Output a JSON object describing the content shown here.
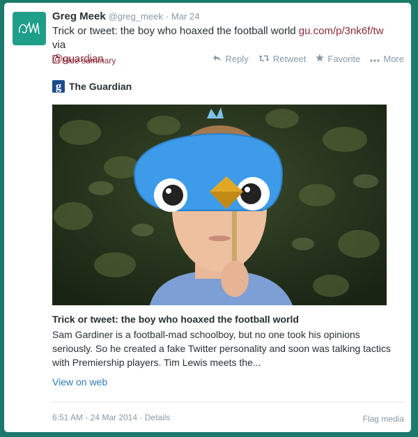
{
  "tweet": {
    "name": "Greg Meek",
    "handle": "@greg_meek",
    "separator": "·",
    "date": "Mar 24",
    "text_prefix": "Trick or tweet: the boy who hoaxed the football world ",
    "link": "gu.com/p/3nk6f/tw",
    "text_via": " via ",
    "mention": "@guardian"
  },
  "summary_toggle": "Hide summary",
  "actions": {
    "reply": "Reply",
    "retweet": "Retweet",
    "favorite": "Favorite",
    "more": "More"
  },
  "card": {
    "source_logo": "g",
    "source_name": "The Guardian",
    "headline": "Trick or tweet: the boy who hoaxed the football world",
    "description": "Sam Gardiner is a football-mad schoolboy, but no one took his opinions seriously. So he created a fake Twitter personality and soon was talking tactics with Premiership players. Tim Lewis meets the...",
    "view_link": "View on web"
  },
  "footer": {
    "timestamp": "6:51 AM - 24 Mar 2014",
    "separator": "·",
    "details": "Details",
    "flag": "Flag media"
  },
  "colors": {
    "background": "#1b7a6b",
    "link": "#8b2a3a",
    "accent": "#2b7bb9",
    "muted": "#8899a6"
  }
}
